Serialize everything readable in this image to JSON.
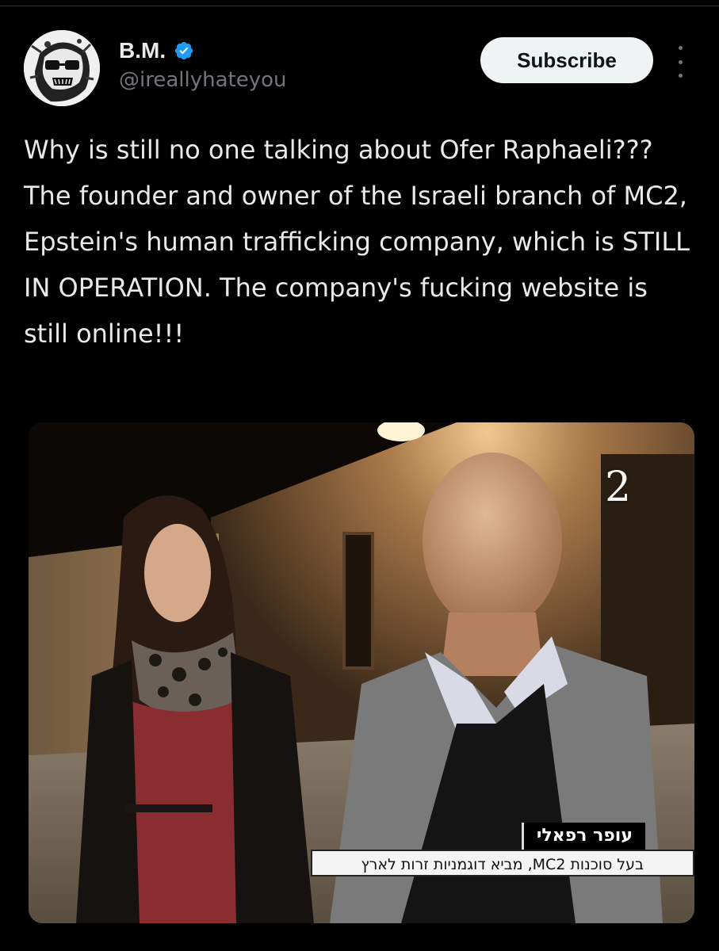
{
  "author": {
    "display_name": "B.M.",
    "handle": "@ireallyhateyou",
    "verified_color": "#1d9bf0"
  },
  "actions": {
    "subscribe_label": "Subscribe"
  },
  "post": {
    "text": "Why is still no one talking about Ofer Raphaeli??? The founder and owner of the Israeli branch of MC2, Epstein's human trafficking company, which is STILL IN OPERATION. The company's fucking website is still online!!!"
  },
  "media": {
    "channel_logo": "2",
    "caption_name": "עופר רפאלי",
    "caption_desc": "בעל סוכנות MC2, מביא דוגמניות זרות לארץ"
  },
  "colors": {
    "background": "#000000",
    "text": "#e7e9ea",
    "secondary": "#71767b",
    "button_bg": "#eff3f4"
  }
}
